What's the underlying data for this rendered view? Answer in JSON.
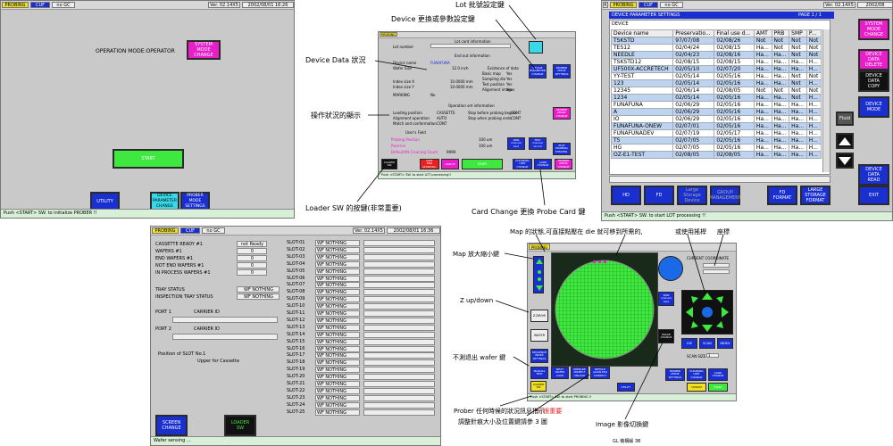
{
  "screen1": {
    "tag_probing": "PROBING",
    "tag_cuf": "CUF",
    "tag_nogc": "no GC",
    "version": "Ver. 02.14X5",
    "datetime": "2002/08/01 16:26",
    "mode_label": "OPERATION MODE:OPERATOR",
    "system_mode_btn": "SYSTEM\nMODE\nCHANGE",
    "start_btn": "START",
    "utility_btn": "UTILITY",
    "device_param_btn": "DEVICE\nPARAMETER\nCHANGE",
    "prober_mode_btn": "PROBER\nMODE\nSETTINGS",
    "status": "Push <START> SW. to initialize PROBER !!"
  },
  "screen2": {
    "tag_probing": "PROBING",
    "lot_info_title": "Lot card information",
    "lot_number_label": "Lot number",
    "end_info_title": "End out information",
    "device_name_label": "Device name",
    "device_name_value": "FUNAFUNA",
    "wafer_size_label": "Wafer Size",
    "wafer_size_value": "12.0 inch",
    "index_size_x_label": "Index size X",
    "index_size_x_value": "10.0000 mm",
    "index_size_y_label": "Index size Y",
    "index_size_y_value": "10.0000 mm",
    "marking_label": "MARKING",
    "marking_value": "No",
    "existence_title": "Existence of data",
    "basic_map_label": "Basic map",
    "basic_map_value": "Yes",
    "sampling_label": "Sampling die",
    "sampling_value": "Yes",
    "test_position_label": "Test position",
    "test_position_value": "Yes",
    "alignment_label": "Alignment images",
    "alignment_value": "Yes",
    "device_param_btn": "DEVICE\nPARAMETER\nCHANGE",
    "prober_mode_btn": "PROBER\nMODE\nSETTINGS",
    "operation_title": "Operation set information",
    "loading_pos_label": "Loading position",
    "loading_pos_value": "CASSETTE",
    "stop_before_label": "Stop before probing begins",
    "stop_before_value": "CONT",
    "alignment_op_label": "Alignment operation",
    "alignment_op_value": "AUTO",
    "stop_probing_label": "Stop when probing ends",
    "stop_probing_value": "CONT",
    "match_label": "Match and conformation",
    "match_value": "CONT",
    "user_field_label": "User's Field",
    "prober_mode_btn2": "PROBER\nMODE\nCHANGE",
    "probing_position_label": "Probing Position",
    "probing_position_value": "100 um",
    "reserved_label": "Reserve",
    "reserved_value": "100 um",
    "default_clean_label": "Default/IN Cleaning Count",
    "default_clean_value": "9999",
    "spin_btn": "SPIN\nmanual\ntest",
    "test_btn": "TEST\nmanual\nrecord",
    "edit_btn": "EDIT\nPROBING\nSTRATEG.",
    "loader_btn": "LOADER\nSW",
    "start_ack_btn": "PART\nEND\nACKNOWL.",
    "group_btn": "GROUP",
    "start_btn": "START",
    "card_change_btn": "CLEANING\nUNIT\nCHANGE",
    "probe_card_btn": "CARD\nCHANGE",
    "mode_btn": "PROBER\nMODE\nCHANGE",
    "status": "Push <START> SW. to start LOT processing!!"
  },
  "screen3": {
    "tag_k": "K",
    "tag_probing": "PROBING",
    "tag_cuf": "CUF",
    "tag_nogc": "no GC",
    "version": "Ver. 02.14X5",
    "date": "2002/08",
    "title": "DEVICE PARAMETER SETTINGS",
    "page": "PAGE 1 / 1",
    "device_header": "DEVICE",
    "columns": [
      "Device name",
      "Preservatio...",
      "Final use d...",
      "AMT",
      "PRB",
      "SMP",
      "P..."
    ],
    "rows": [
      {
        "c": [
          "TSKSTD",
          "97/07/08",
          "02/08/26",
          "Not",
          "Not",
          "Not",
          "Not"
        ],
        "hl": true
      },
      {
        "c": [
          "TES12",
          "02/04/24",
          "02/08/15",
          "Ha...",
          "Not",
          "Not",
          "Not"
        ],
        "hl": false
      },
      {
        "c": [
          "NEEDLE",
          "02/04/23",
          "02/08/16",
          "Ha...",
          "Ha...",
          "Not",
          "Not"
        ],
        "hl": true
      },
      {
        "c": [
          "TSKSTD12",
          "02/08/15",
          "02/08/15",
          "Ha...",
          "Ha...",
          "Ha...",
          "H..."
        ],
        "hl": false
      },
      {
        "c": [
          "UF500X-ACCRETECH",
          "02/05/10",
          "02/07/20",
          "Ha...",
          "Ha...",
          "Ha...",
          "H..."
        ],
        "hl": true
      },
      {
        "c": [
          "YY-TEST",
          "02/05/14",
          "02/05/16",
          "Ha...",
          "Ha...",
          "Not",
          "Not"
        ],
        "hl": false
      },
      {
        "c": [
          "123",
          "02/05/14",
          "02/05/16",
          "Ha...",
          "Ha...",
          "Not",
          "H..."
        ],
        "hl": true
      },
      {
        "c": [
          "12345",
          "02/06/14",
          "02/08/05",
          "Not",
          "Not",
          "Not",
          "Not"
        ],
        "hl": false
      },
      {
        "c": [
          "1234",
          "02/05/14",
          "02/05/16",
          "Ha...",
          "Ha...",
          "Not",
          "H..."
        ],
        "hl": true
      },
      {
        "c": [
          "FUNAFUNA",
          "02/06/29",
          "02/05/16",
          "Ha...",
          "Ha...",
          "Ha...",
          "H..."
        ],
        "hl": false
      },
      {
        "c": [
          "A",
          "02/06/29",
          "02/05/16",
          "Ha...",
          "Ha...",
          "Ha...",
          "H..."
        ],
        "hl": true
      },
      {
        "c": [
          "IO",
          "02/06/29",
          "02/05/16",
          "Ha...",
          "Ha...",
          "Ha...",
          "H..."
        ],
        "hl": false
      },
      {
        "c": [
          "FUNAFUNA-ONEW",
          "02/07/01",
          "02/05/16",
          "Ha...",
          "Ha...",
          "Ha...",
          "H..."
        ],
        "hl": true
      },
      {
        "c": [
          "FUNAFUNADEV",
          "02/07/19",
          "02/05/17",
          "Ha...",
          "Ha...",
          "Ha...",
          "H..."
        ],
        "hl": false
      },
      {
        "c": [
          "T5",
          "02/07/05",
          "02/05/16",
          "Ha...",
          "Ha...",
          "Ha...",
          "H..."
        ],
        "hl": true
      },
      {
        "c": [
          "HG",
          "02/07/05",
          "02/05/16",
          "Ha...",
          "Ha...",
          "Ha...",
          "H..."
        ],
        "hl": false
      },
      {
        "c": [
          "OZ-E1-TEST",
          "02/08/05",
          "02/08/05",
          "Ha...",
          "Ha...",
          "Ha...",
          "H..."
        ],
        "hl": true
      }
    ],
    "system_mode_btn": "SYSTEM\nMODE\nCHANGE",
    "data_delete_btn": "DEVICE\nDATA\nDELETE",
    "data_copy_btn": "DEVICE\nDATA\nCOPY",
    "device_mode_btn": "DEVICE\nMODE",
    "fluid_btn": "Fluid",
    "data_read_btn": "DEVICE\nDATA\nREAD",
    "exit_btn": "EXIT",
    "hd_btn": "HD",
    "fd_btn": "FD",
    "large_storage_btn": "Large\nStorage\nDevice",
    "group_mgmt_btn": "GROUP\nMANAGEMENT",
    "fd_format_btn": "FD\nFORMAT",
    "large_format_btn": "LARGE\nSTORAGE\nFORMAT",
    "status": "Push <START> SW. to start LOT processing !!"
  },
  "screen4": {
    "tag_probing": "PROBING",
    "tag_cuf": "CUF",
    "tag_nogc": "no GC",
    "version": "Ver. 02.14X5",
    "datetime": "2002/08/01 16:36",
    "cassette_ready_label": "CASSETTE READY #1",
    "cassette_ready_value": "not Ready",
    "wafers_label": "WAFERS #1",
    "wafers_value": "0",
    "end_wafers_label": "END WAFERS #1",
    "end_wafers_value": "0",
    "not_end_label": "NOT END WAFERS #1",
    "not_end_value": "0",
    "in_process_label": "IN PROCESS WAFERS #1",
    "in_process_value": "0",
    "tray_status_label": "TRAY STATUS",
    "tray_status_value": "WF NOTHING",
    "inspection_tray_label": "INSPECTION TRAY STATUS",
    "inspection_tray_value": "WF NOTHING",
    "port1_label": "PORT 1",
    "carrier1_label": "CARRIER ID",
    "port2_label": "PORT 2",
    "carrier2_label": "CARRIER ID",
    "position_label": "Position of SLOT No.1",
    "upper_label": "Upper for Cassette",
    "screen_change_btn": "SCREEN\nCHANGE",
    "loader_sw_btn": "LOADER\nSW",
    "slots": [
      "SLOT-01",
      "SLOT-02",
      "SLOT-03",
      "SLOT-04",
      "SLOT-05",
      "SLOT-06",
      "SLOT-07",
      "SLOT-08",
      "SLOT-09",
      "SLOT-10",
      "SLOT-11",
      "SLOT-12",
      "SLOT-13",
      "SLOT-14",
      "SLOT-15",
      "SLOT-16",
      "SLOT-17",
      "SLOT-18",
      "SLOT-19",
      "SLOT-20",
      "SLOT-21",
      "SLOT-22",
      "SLOT-23",
      "SLOT-24",
      "SLOT-25"
    ],
    "slot_status": "WF NOTHING",
    "status": "Wafer sensing ..."
  },
  "screen5": {
    "tag_probing": "PROBING",
    "current_coord": "CURRENT COORDINATE",
    "zdrive_btn": "Z-DRIVE",
    "wafer_btn": "WAFER",
    "sequence_btn": "SEQUENCE\nINDEX\nSETTINGS",
    "manual_btn": "MANUAL\nTEST",
    "next_wafer_btn": "NEXT\nWAFER\nLOAD",
    "prepare_btn": "PREPARE\nINSPECT\nUNLOAD",
    "needle_btn": "NEEDLE\nALIGN POS\nCORRECT",
    "prober_mode_btn": "PROBER\nMODE\nSETTINGS",
    "cleaning_btn": "CLEANING\nUNIT\nCHANGE",
    "card_change_btn": "CARD\nCHANGE",
    "spin_btn": "SPIN\nmanual\ntest",
    "image_btn": "IMAGE\nCHANGE",
    "loader_btn": "LOADER\nSW",
    "utility_btn": "UTILITY",
    "data_btn": "DATA/M",
    "start_btn": "START",
    "die_btn": "DIE",
    "scan_btn": "SCAN",
    "index_btn": "INDEX",
    "scan_size_label": "SCAN SIZE",
    "scan_size_value": "1",
    "status": "Push <START> SW. to start PROBING !!"
  },
  "annotations": {
    "lot_key": "Lot 批號設定鍵",
    "device_key": "Device 更換或參數設定鍵",
    "device_data": "Device Data 狀況",
    "op_status": "操作狀況的顯示",
    "loader_sw": "Loader SW 的按鍵(非常重要)",
    "card_change": "Card Change 更換 Probe Card 鍵",
    "map_state": "Map 的狀態,可直接點壓在 die 就可移到所需的,",
    "or_joystick": "或使用搖桿",
    "coord": "座標",
    "map_zoom": "Map 放大縮小鍵",
    "z_updown": "Z up/down",
    "no_test_exit": "不測退出 wafer 鍵",
    "prober_status": "Prober 任何時候的狀況訊息指示",
    "important": "一 很重要",
    "adjust": "調整針痕大小及位置鍵請參 3 圖",
    "image_switch": "Image 影像切換鍵",
    "footer_mark": "GL 機構解 3B"
  }
}
